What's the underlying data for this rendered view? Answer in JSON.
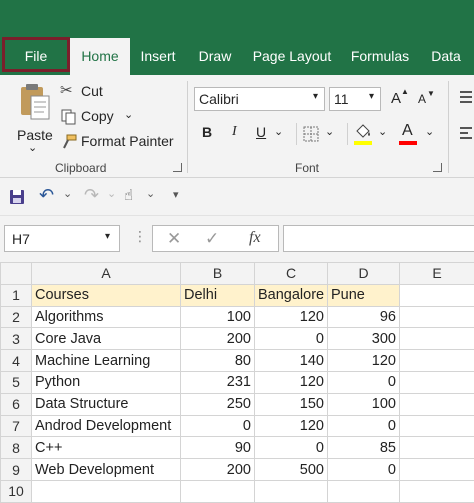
{
  "tabs": [
    "File",
    "Home",
    "Insert",
    "Draw",
    "Page Layout",
    "Formulas",
    "Data"
  ],
  "active_tab": "Home",
  "clipboard": {
    "paste": "Paste",
    "cut": "Cut",
    "copy": "Copy",
    "format_painter": "Format Painter",
    "group_label": "Clipboard"
  },
  "font": {
    "name": "Calibri",
    "size": "11",
    "bold": "B",
    "italic": "I",
    "underline": "U",
    "font_color_letter": "A",
    "grow": "A",
    "shrink": "A",
    "group_label": "Font",
    "fill_color": "#ffff00",
    "text_color": "#ff0000"
  },
  "formula_bar": {
    "name_box": "H7",
    "fx": "fx",
    "formula": ""
  },
  "sheet": {
    "columns": [
      "A",
      "B",
      "C",
      "D",
      "E"
    ],
    "rows": [
      {
        "n": "1",
        "cells": [
          "Courses",
          "Delhi",
          "Bangalore",
          "Pune",
          ""
        ]
      },
      {
        "n": "2",
        "cells": [
          "Algorithms",
          "100",
          "120",
          "96",
          ""
        ]
      },
      {
        "n": "3",
        "cells": [
          "Core Java",
          "200",
          "0",
          "300",
          ""
        ]
      },
      {
        "n": "4",
        "cells": [
          "Machine Learning",
          "80",
          "140",
          "120",
          ""
        ]
      },
      {
        "n": "5",
        "cells": [
          "Python",
          "231",
          "120",
          "0",
          ""
        ]
      },
      {
        "n": "6",
        "cells": [
          "Data Structure",
          "250",
          "150",
          "100",
          ""
        ]
      },
      {
        "n": "7",
        "cells": [
          "Androd Development",
          "0",
          "120",
          "0",
          ""
        ]
      },
      {
        "n": "8",
        "cells": [
          "C++",
          "90",
          "0",
          "85",
          ""
        ]
      },
      {
        "n": "9",
        "cells": [
          "Web Development",
          "200",
          "500",
          "0",
          ""
        ]
      },
      {
        "n": "10",
        "cells": [
          "",
          "",
          "",
          "",
          ""
        ]
      }
    ]
  },
  "theme": {
    "accent": "#217346",
    "file_outline": "#7a1f2b",
    "header_fill": "#fff2cc"
  }
}
